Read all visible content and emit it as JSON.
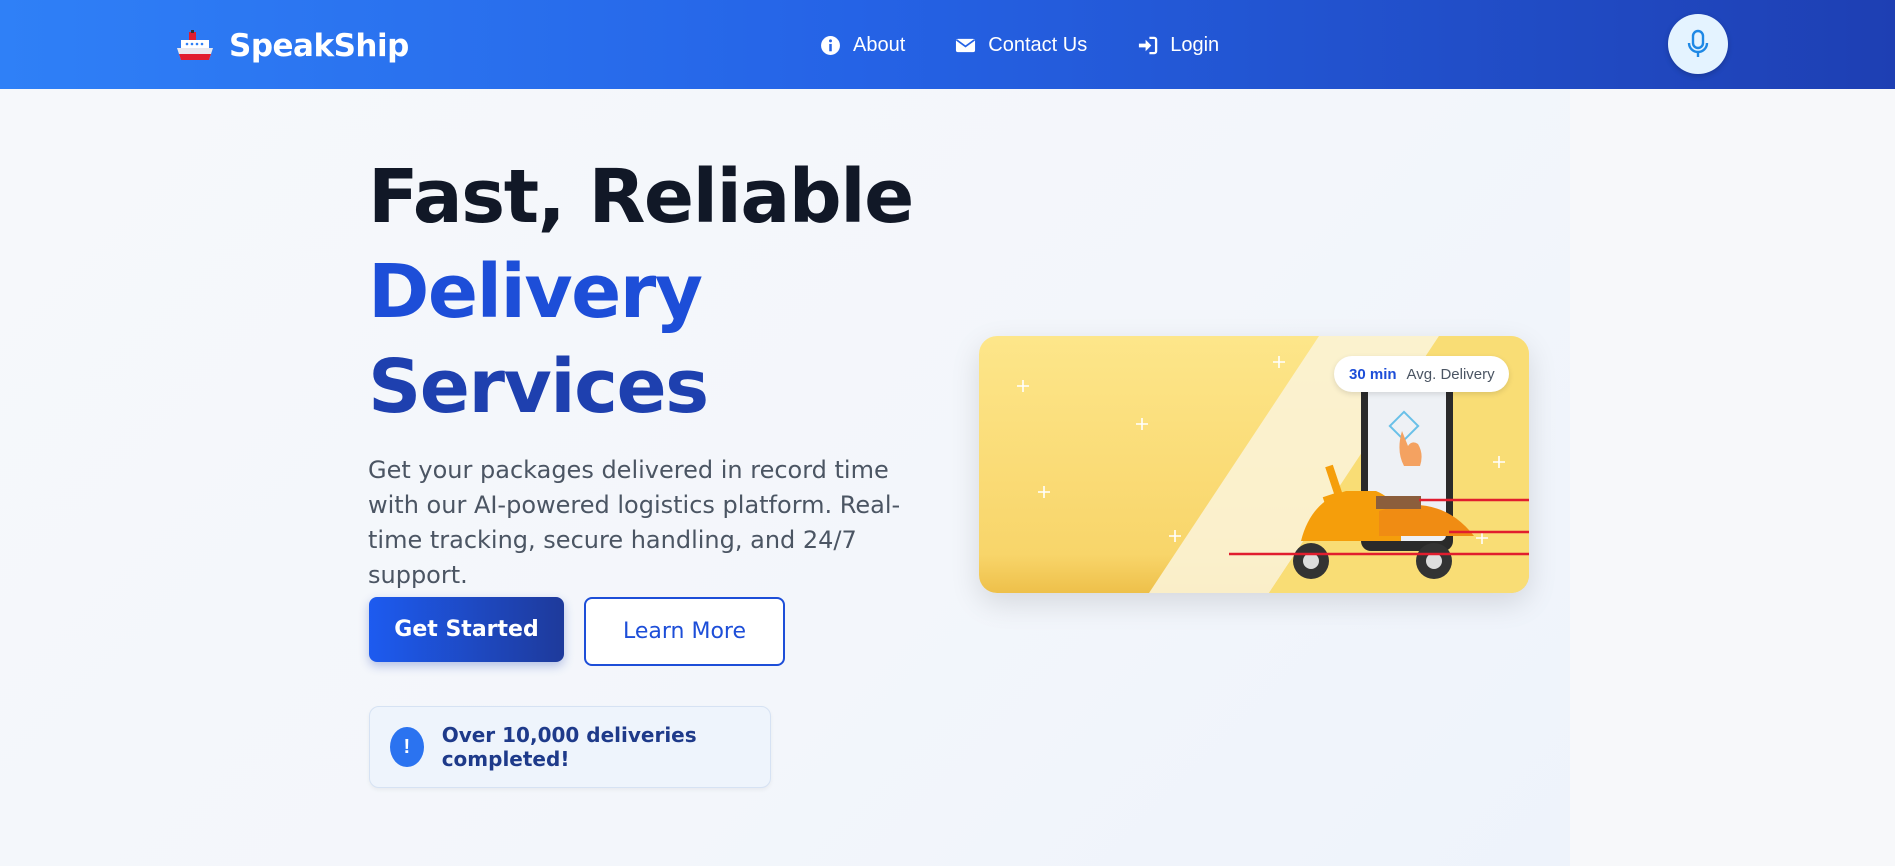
{
  "nav": {
    "brand": "SpeakShip",
    "links": [
      {
        "label": "About",
        "icon": "info-icon"
      },
      {
        "label": "Contact Us",
        "icon": "envelope-icon"
      },
      {
        "label": "Login",
        "icon": "login-icon"
      }
    ],
    "mic_icon": "microphone-icon"
  },
  "hero": {
    "headline_1": "Fast, Reliable",
    "headline_2": "Delivery",
    "headline_3": "Services",
    "subtext": "Get your packages delivered in record time with our AI-powered logistics platform. Real-time tracking, secure handling, and 24/7 support.",
    "primary_button": "Get Started",
    "secondary_button": "Learn More",
    "notice_icon": "!",
    "notice_text": "Over 10,000 deliveries completed!"
  },
  "illustration": {
    "badge_value": "30 min",
    "badge_label": "Avg. Delivery"
  },
  "colors": {
    "nav_start": "#2f80f7",
    "nav_end": "#1e3fb3",
    "accent": "#1d4ed8",
    "headline_dark": "#111827"
  }
}
